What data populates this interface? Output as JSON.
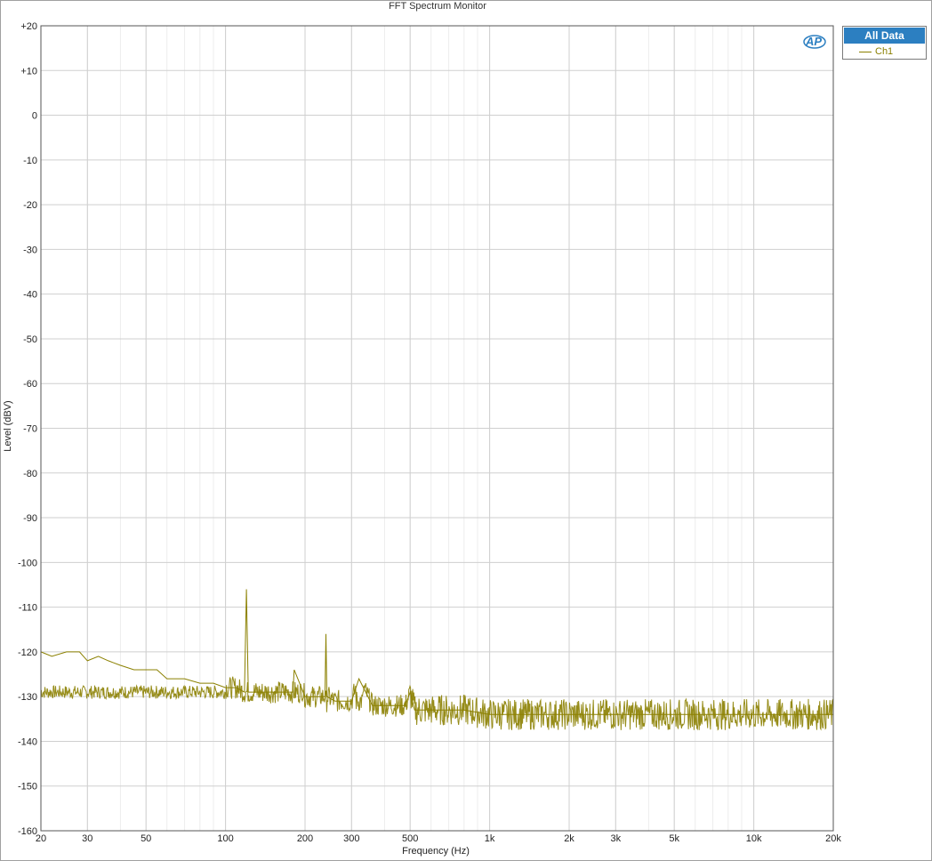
{
  "chart_data": {
    "type": "line",
    "title": "FFT Spectrum Monitor",
    "xlabel": "Frequency (Hz)",
    "ylabel": "Level (dBV)",
    "xscale": "log",
    "xlim": [
      20,
      20000
    ],
    "ylim": [
      -160,
      20
    ],
    "grid": true,
    "legend_placement": "top-right, outside plot",
    "legend_title": "All Data",
    "x_ticks": [
      {
        "value": 20,
        "label": "20"
      },
      {
        "value": 30,
        "label": "30"
      },
      {
        "value": 50,
        "label": "50"
      },
      {
        "value": 100,
        "label": "100"
      },
      {
        "value": 200,
        "label": "200"
      },
      {
        "value": 300,
        "label": "300"
      },
      {
        "value": 500,
        "label": "500"
      },
      {
        "value": 1000,
        "label": "1k"
      },
      {
        "value": 2000,
        "label": "2k"
      },
      {
        "value": 3000,
        "label": "3k"
      },
      {
        "value": 5000,
        "label": "5k"
      },
      {
        "value": 10000,
        "label": "10k"
      },
      {
        "value": 20000,
        "label": "20k"
      }
    ],
    "y_ticks": [
      {
        "value": 20,
        "label": "+20"
      },
      {
        "value": 10,
        "label": "+10"
      },
      {
        "value": 0,
        "label": "0"
      },
      {
        "value": -10,
        "label": "-10"
      },
      {
        "value": -20,
        "label": "-20"
      },
      {
        "value": -30,
        "label": "-30"
      },
      {
        "value": -40,
        "label": "-40"
      },
      {
        "value": -50,
        "label": "-50"
      },
      {
        "value": -60,
        "label": "-60"
      },
      {
        "value": -70,
        "label": "-70"
      },
      {
        "value": -80,
        "label": "-80"
      },
      {
        "value": -90,
        "label": "-90"
      },
      {
        "value": -100,
        "label": "-100"
      },
      {
        "value": -110,
        "label": "-110"
      },
      {
        "value": -120,
        "label": "-120"
      },
      {
        "value": -130,
        "label": "-130"
      },
      {
        "value": -140,
        "label": "-140"
      },
      {
        "value": -150,
        "label": "-150"
      },
      {
        "value": -160,
        "label": "-160"
      }
    ],
    "series": [
      {
        "name": "Ch1",
        "color": "#8b8000",
        "x": [
          20,
          22,
          25,
          28,
          30,
          33,
          36,
          40,
          45,
          50,
          55,
          60,
          70,
          80,
          90,
          100,
          110,
          118,
          120,
          122,
          130,
          150,
          170,
          180,
          182,
          200,
          230,
          238,
          240,
          242,
          260,
          300,
          320,
          360,
          400,
          480,
          500,
          520,
          600,
          700,
          800,
          1000,
          1200,
          1500,
          2000,
          2500,
          3000,
          3500,
          4000,
          5000,
          6000,
          7000,
          8000,
          9000,
          10000,
          12000,
          15000,
          18000,
          20000
        ],
        "y": [
          -120,
          -121,
          -120,
          -120,
          -122,
          -121,
          -122,
          -123,
          -124,
          -124,
          -124,
          -126,
          -126,
          -127,
          -127,
          -128,
          -128,
          -129,
          -106,
          -129,
          -129,
          -129,
          -129,
          -129,
          -124,
          -130,
          -130,
          -130,
          -116,
          -130,
          -131,
          -131,
          -126,
          -132,
          -132,
          -132,
          -129,
          -133,
          -133,
          -133,
          -133,
          -134,
          -134,
          -134,
          -134,
          -134,
          -134,
          -134,
          -134,
          -134,
          -134,
          -134,
          -134,
          -134,
          -134,
          -134,
          -134,
          -134,
          -134
        ]
      }
    ]
  }
}
